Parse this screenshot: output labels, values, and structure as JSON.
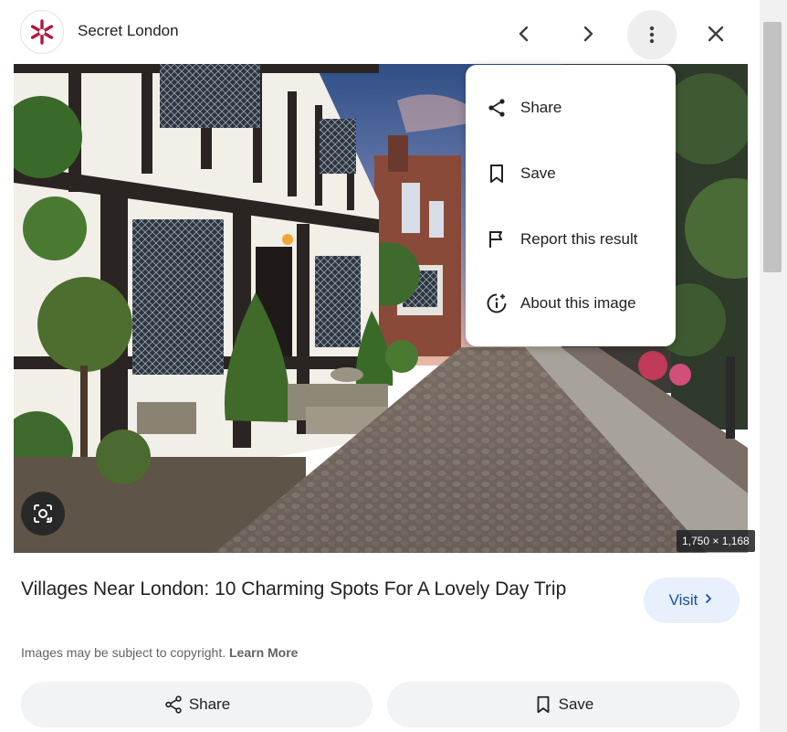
{
  "header": {
    "site_name": "Secret London",
    "logo_icon": "asterisk-logo-icon",
    "brand_color": "#b0183d",
    "prev_icon": "chevron-left-icon",
    "next_icon": "chevron-right-icon",
    "more_icon": "more-vert-icon",
    "close_icon": "close-icon"
  },
  "image": {
    "dimensions": "1,750 × 1,168",
    "lens_icon": "google-lens-icon"
  },
  "menu": {
    "items": [
      {
        "label": "Share",
        "icon": "share-icon"
      },
      {
        "label": "Save",
        "icon": "bookmark-icon"
      },
      {
        "label": "Report this result",
        "icon": "flag-icon"
      },
      {
        "label": "About this image",
        "icon": "info-icon"
      }
    ]
  },
  "details": {
    "title": "Villages Near London: 10 Charming Spots For A Lovely Day Trip",
    "visit_label": "Visit",
    "copyright_text": "Images may be subject to copyright.",
    "learn_more": "Learn More"
  },
  "actions": {
    "share_label": "Share",
    "save_label": "Save"
  }
}
